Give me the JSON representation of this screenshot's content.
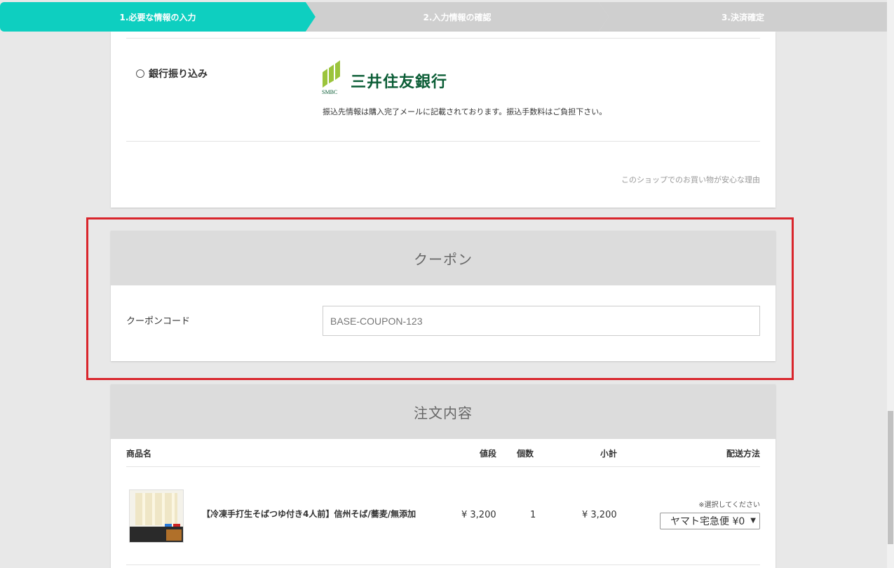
{
  "steps": [
    {
      "label": "1.必要な情報の入力"
    },
    {
      "label": "2.入力情報の確認"
    },
    {
      "label": "3.決済確定"
    }
  ],
  "payment": {
    "option_label": "銀行振り込み",
    "logo_text": "SMBC",
    "bank_name": "三井住友銀行",
    "note": "振込先情報は購入完了メールに記載されております。振込手数料はご負担下さい。",
    "safe_link": "このショップでのお買い物が安心な理由"
  },
  "coupon": {
    "title": "クーポン",
    "label": "クーポンコード",
    "placeholder": "BASE-COUPON-123"
  },
  "order": {
    "title": "注文内容",
    "headers": {
      "name": "商品名",
      "price": "値段",
      "qty": "個数",
      "subtotal": "小計",
      "shipping": "配送方法"
    },
    "items": [
      {
        "name": "【冷凍手打生そばつゆ付き4人前】信州そば/蕎麦/無添加",
        "price": "¥ 3,200",
        "qty": "1",
        "subtotal": "¥ 3,200",
        "shipping_note": "※選択してください",
        "shipping_value": "ヤマト宅急便 ¥0"
      }
    ]
  },
  "colors": {
    "accent": "#0ecfc0",
    "highlight": "#d9252c",
    "bank_green": "#0b5d36"
  }
}
